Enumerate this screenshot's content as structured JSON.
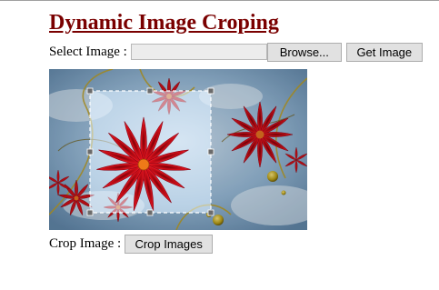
{
  "page": {
    "title": "Dynamic Image Croping"
  },
  "select_row": {
    "label": "Select Image :",
    "file_value": "",
    "browse_label": "Browse...",
    "get_image_label": "Get Image"
  },
  "image": {
    "description_icon": "flower-image"
  },
  "crop_row": {
    "label": "Crop Image :",
    "crop_button_label": "Crop Images"
  },
  "colors": {
    "title": "#7a0000",
    "button_bg": "#e1e1e1",
    "button_border": "#adadad",
    "flower_red": "#d4101a",
    "sky_blue": "#8fb3d0"
  }
}
